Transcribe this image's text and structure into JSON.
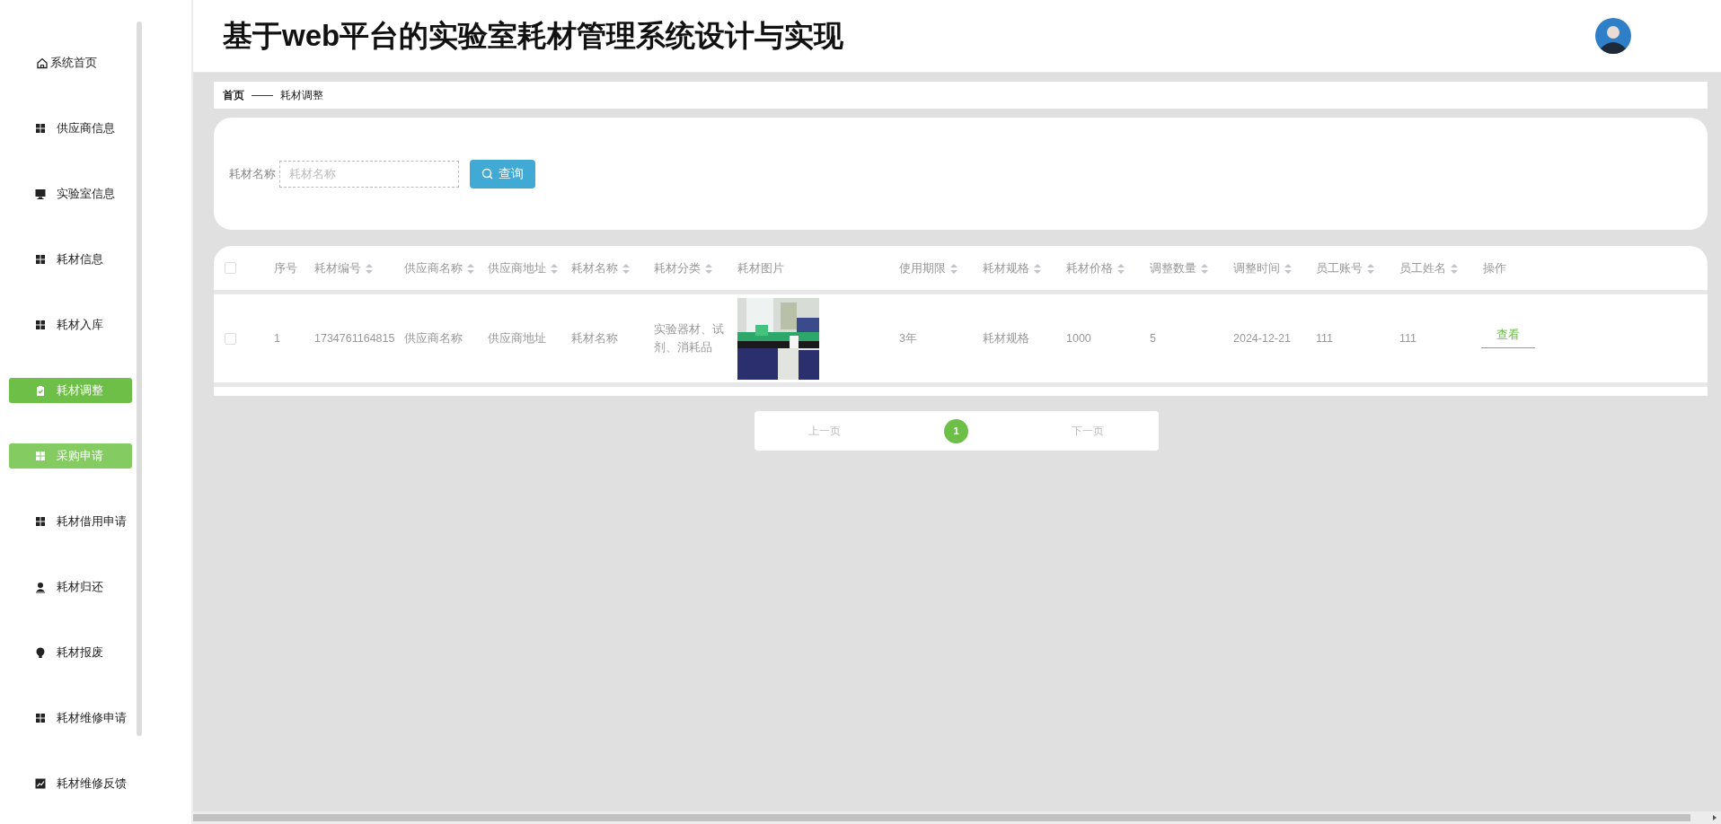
{
  "sidebar": {
    "items": [
      {
        "label": "系统首页",
        "kind": "home",
        "selected": false,
        "hovered": false
      },
      {
        "label": "供应商信息",
        "kind": "grid",
        "selected": false,
        "hovered": false
      },
      {
        "label": "实验室信息",
        "kind": "monitor",
        "selected": false,
        "hovered": false
      },
      {
        "label": "耗材信息",
        "kind": "grid",
        "selected": false,
        "hovered": false
      },
      {
        "label": "耗材入库",
        "kind": "grid",
        "selected": false,
        "hovered": false
      },
      {
        "label": "耗材调整",
        "kind": "clipboard",
        "selected": true,
        "hovered": false
      },
      {
        "label": "采购申请",
        "kind": "grid",
        "selected": false,
        "hovered": true
      },
      {
        "label": "耗材借用申请",
        "kind": "grid",
        "selected": false,
        "hovered": false
      },
      {
        "label": "耗材归还",
        "kind": "person",
        "selected": false,
        "hovered": false
      },
      {
        "label": "耗材报废",
        "kind": "bulb",
        "selected": false,
        "hovered": false
      },
      {
        "label": "耗材维修申请",
        "kind": "grid",
        "selected": false,
        "hovered": false
      },
      {
        "label": "耗材维修反馈",
        "kind": "chart",
        "selected": false,
        "hovered": false
      }
    ]
  },
  "header": {
    "title": "基于web平台的实验室耗材管理系统设计与实现"
  },
  "breadcrumb": [
    {
      "label": "首页",
      "kind": "link"
    },
    {
      "label": "——",
      "kind": "separator"
    },
    {
      "label": "耗材调整",
      "kind": "current"
    }
  ],
  "search": {
    "label": "耗材名称",
    "placeholder": "耗材名称",
    "button": "查询"
  },
  "table": {
    "all_checked": false,
    "columns": [
      {
        "label": "序号",
        "sortable": false
      },
      {
        "label": "耗材编号",
        "sortable": true
      },
      {
        "label": "供应商名称",
        "sortable": true
      },
      {
        "label": "供应商地址",
        "sortable": true
      },
      {
        "label": "耗材名称",
        "sortable": true
      },
      {
        "label": "耗材分类",
        "sortable": true
      },
      {
        "label": "耗材图片",
        "sortable": false
      },
      {
        "label": "使用期限",
        "sortable": true
      },
      {
        "label": "耗材规格",
        "sortable": true
      },
      {
        "label": "耗材价格",
        "sortable": true
      },
      {
        "label": "调整数量",
        "sortable": true
      },
      {
        "label": "调整时间",
        "sortable": true
      },
      {
        "label": "员工账号",
        "sortable": true
      },
      {
        "label": "员工姓名",
        "sortable": true
      },
      {
        "label": "操作",
        "sortable": false
      }
    ],
    "rows": [
      {
        "checked": false,
        "cells": [
          {
            "kind": "text",
            "text": "1"
          },
          {
            "kind": "text",
            "text": "1734761164815"
          },
          {
            "kind": "text",
            "text": "供应商名称"
          },
          {
            "kind": "text",
            "text": "供应商地址"
          },
          {
            "kind": "text",
            "text": "耗材名称"
          },
          {
            "kind": "text",
            "text": "实验器材、试剂、消耗品"
          },
          {
            "kind": "picture"
          },
          {
            "kind": "text",
            "text": "3年"
          },
          {
            "kind": "text",
            "text": "耗材规格"
          },
          {
            "kind": "text",
            "text": "1000"
          },
          {
            "kind": "text",
            "text": "5"
          },
          {
            "kind": "text",
            "text": "2024-12-21"
          },
          {
            "kind": "text",
            "text": "111"
          },
          {
            "kind": "text",
            "text": "111"
          },
          {
            "kind": "action",
            "text": "查看"
          }
        ]
      }
    ]
  },
  "pagination": {
    "prev": "上一页",
    "pages": [
      {
        "label": "1",
        "selected": true
      }
    ],
    "next": "下一页"
  }
}
